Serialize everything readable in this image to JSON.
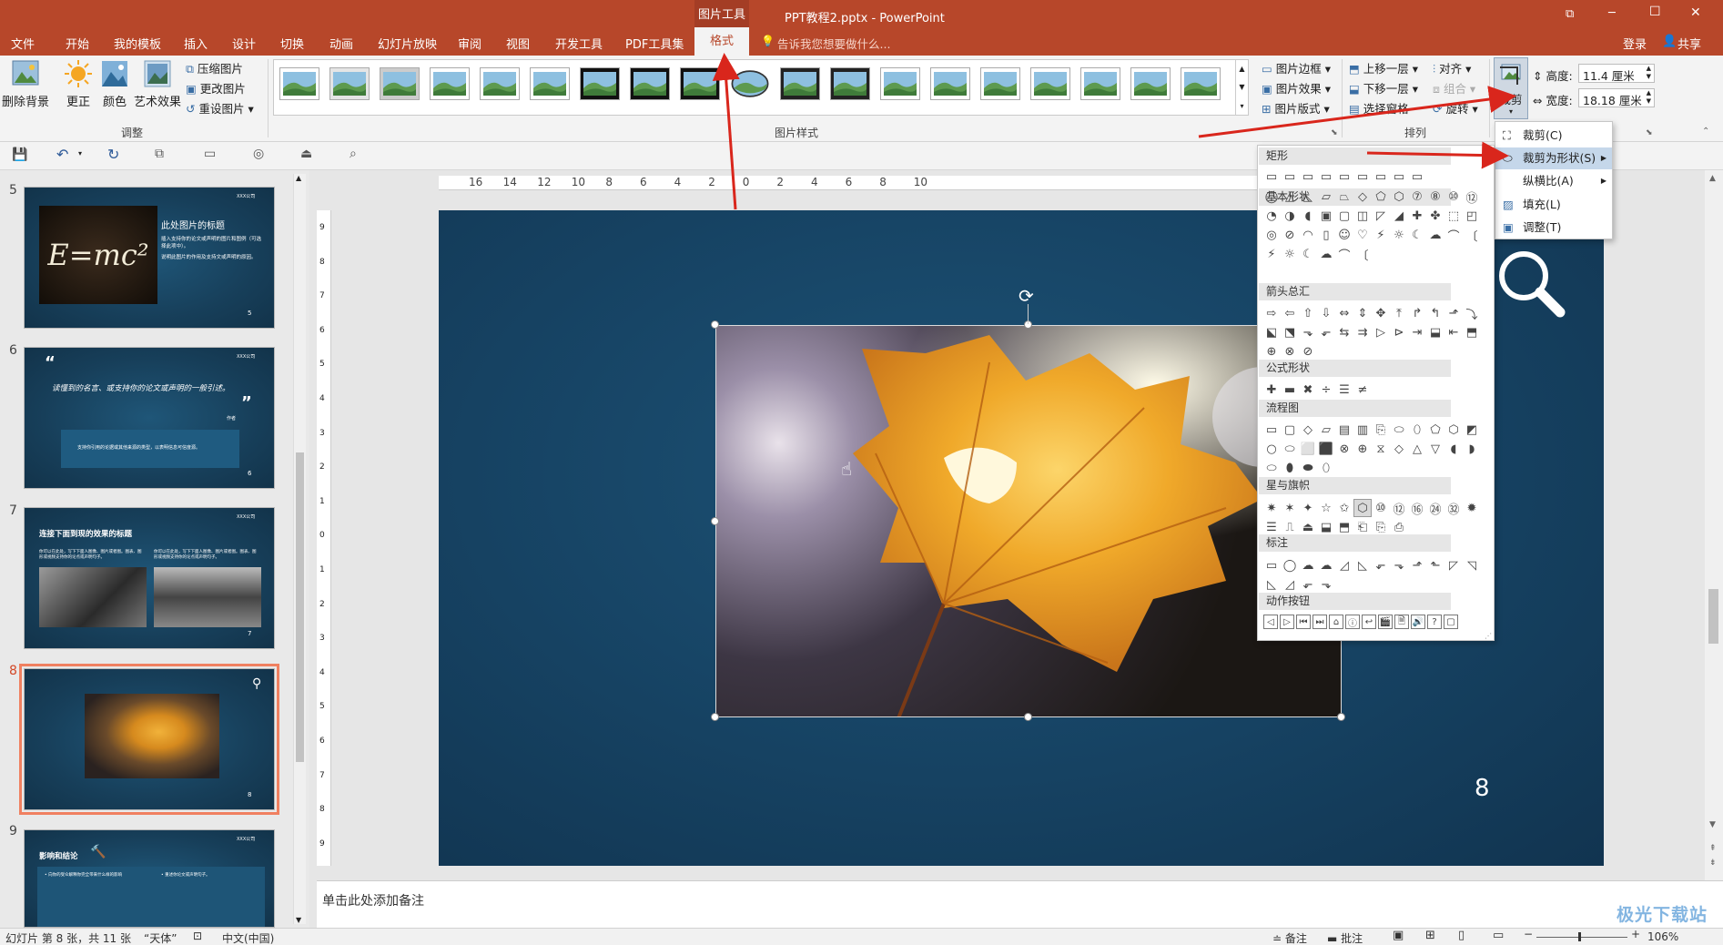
{
  "window": {
    "title": "PPT教程2.pptx - PowerPoint",
    "context_tool": "图片工具"
  },
  "title_controls": {
    "restore": "⧉",
    "minimize": "─",
    "maximize": "☐",
    "close": "✕"
  },
  "tabs": [
    "文件",
    "开始",
    "我的模板",
    "插入",
    "设计",
    "切换",
    "动画",
    "幻灯片放映",
    "审阅",
    "视图",
    "开发工具",
    "PDF工具集"
  ],
  "active_tab": "格式",
  "tellme": "告诉我您想要做什么...",
  "account": {
    "login": "登录",
    "share": "共享"
  },
  "ribbon": {
    "adjust": {
      "remove_bg": "删除背景",
      "correct": "更正",
      "color": "颜色",
      "artistic": "艺术效果",
      "compress": "压缩图片",
      "change": "更改图片",
      "reset": "重设图片",
      "label": "调整"
    },
    "styles": {
      "label": "图片样式",
      "border": "图片边框",
      "effects": "图片效果",
      "layout": "图片版式"
    },
    "arrange": {
      "label": "排列",
      "forward": "上移一层",
      "backward": "下移一层",
      "selection": "选择窗格",
      "align": "对齐",
      "group": "组合",
      "rotate": "旋转"
    },
    "size": {
      "crop": "裁剪",
      "height_label": "高度:",
      "height_value": "11.4 厘米",
      "width_label": "宽度:",
      "width_value": "18.18 厘米"
    }
  },
  "crop_menu": {
    "crop": "裁剪(C)",
    "crop_to_shape": "裁剪为形状(S)",
    "aspect_ratio": "纵横比(A)",
    "fill": "填充(L)",
    "fit": "调整(T)"
  },
  "shape_categories": [
    "矩形",
    "基本形状",
    "箭头总汇",
    "公式形状",
    "流程图",
    "星与旗帜",
    "标注",
    "动作按钮"
  ],
  "thumbnails": [
    {
      "num": "5",
      "title": "此处图片的标题",
      "body": "插入支持你的论文或声明的图片和图例（可选择此项中）。",
      "body2": "说明此图片的作用及支持文或声明的原因。",
      "footer": "5",
      "formula": "E=mc²",
      "logo": "XXX公司"
    },
    {
      "num": "6",
      "quote_open": "“",
      "quote": "读懂到的名言、或支持你的论文或声明的一般引述。",
      "quote_close": "”",
      "author": "作者",
      "body": "支持你引用的论据或其他来源的类型，以表明信息可信度源。",
      "footer": "6",
      "logo": "XXX公司"
    },
    {
      "num": "7",
      "title": "连接下面到现的效果的标题",
      "body1": "你可以在此处，写下下面人图像、图片或者图。图表、图形或视频支持你的论点或声明句子。",
      "body2": "你可以在此处，写下下面人图像、图片或者图。图表、图形或视频支持你的论点或声明句子。",
      "footer": "7",
      "logo": "XXX公司"
    },
    {
      "num": "8",
      "footer": "8"
    },
    {
      "num": "9",
      "title": "影响和结论",
      "bullet1": "• 向你的受众解释你完全带来什么样的影响",
      "bullet2": "• 重述你论文或声明句子。",
      "logo": "XXX公司"
    }
  ],
  "slide": {
    "number": "8"
  },
  "notes_placeholder": "单击此处添加备注",
  "status": {
    "slide_info": "幻灯片 第 8 张，共 11 张",
    "theme": "“天体”",
    "language": "中文(中国)",
    "notes": "备注",
    "comments": "批注",
    "zoom": "106%"
  },
  "ruler_h": [
    "16",
    "14",
    "12",
    "10",
    "8",
    "6",
    "4",
    "2",
    "0",
    "2",
    "4",
    "6",
    "8",
    "10"
  ],
  "ruler_v": [
    "9",
    "8",
    "7",
    "6",
    "5",
    "4",
    "3",
    "2",
    "1",
    "0",
    "1",
    "2",
    "3",
    "4",
    "5",
    "6",
    "7",
    "8",
    "9"
  ],
  "watermark": "极光下载站",
  "colors": {
    "accent": "#b7472a",
    "slide_bg": "#174566",
    "selection": "#f08060",
    "arrow": "#d9261c"
  }
}
